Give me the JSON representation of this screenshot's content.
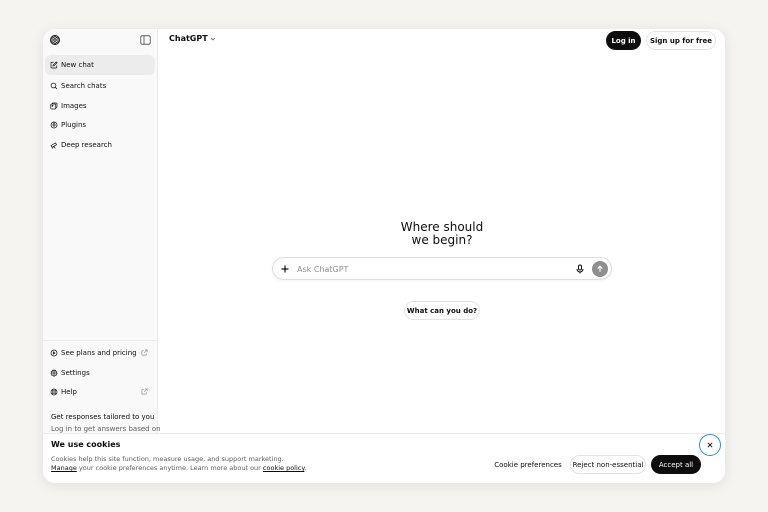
{
  "sidebar": {
    "logo_icon": "openai-logo-icon",
    "toggle_icon": "sidebar-toggle-icon",
    "items": [
      {
        "label": "New chat",
        "icon": "pencil-square-icon",
        "active": true
      },
      {
        "label": "Search chats",
        "icon": "search-icon"
      },
      {
        "label": "Images",
        "icon": "images-icon"
      },
      {
        "label": "Plugins",
        "icon": "plugins-icon"
      },
      {
        "label": "Deep research",
        "icon": "telescope-icon"
      }
    ],
    "bottom_items": [
      {
        "label": "See plans and pricing",
        "icon": "plans-icon",
        "external": true
      },
      {
        "label": "Settings",
        "icon": "gear-icon"
      },
      {
        "label": "Help",
        "icon": "help-icon",
        "external": true
      }
    ],
    "tailored": {
      "title": "Get responses tailored to you",
      "subtitle": "Log in to get answers based on"
    }
  },
  "header": {
    "model": "ChatGPT",
    "login": "Log in",
    "signup": "Sign up for free"
  },
  "main": {
    "hero_line1": "Where should",
    "hero_line2": "we begin?",
    "composer_placeholder": "Ask ChatGPT",
    "composer_value": "",
    "suggestion": "What can you do?"
  },
  "cookie": {
    "title": "We use cookies",
    "line1": "Cookies help this site function, measure usage, and support marketing.",
    "manage": "Manage",
    "line2_mid": " your cookie preferences anytime. Learn more about our ",
    "policy": "cookie policy",
    "line2_end": ".",
    "preferences": "Cookie preferences",
    "reject": "Reject non-essential",
    "accept": "Accept all"
  },
  "colors": {
    "accent_dark": "#0d0d0d",
    "focus_ring": "#2b8fd6",
    "sidebar_bg": "#f9f9f9"
  }
}
